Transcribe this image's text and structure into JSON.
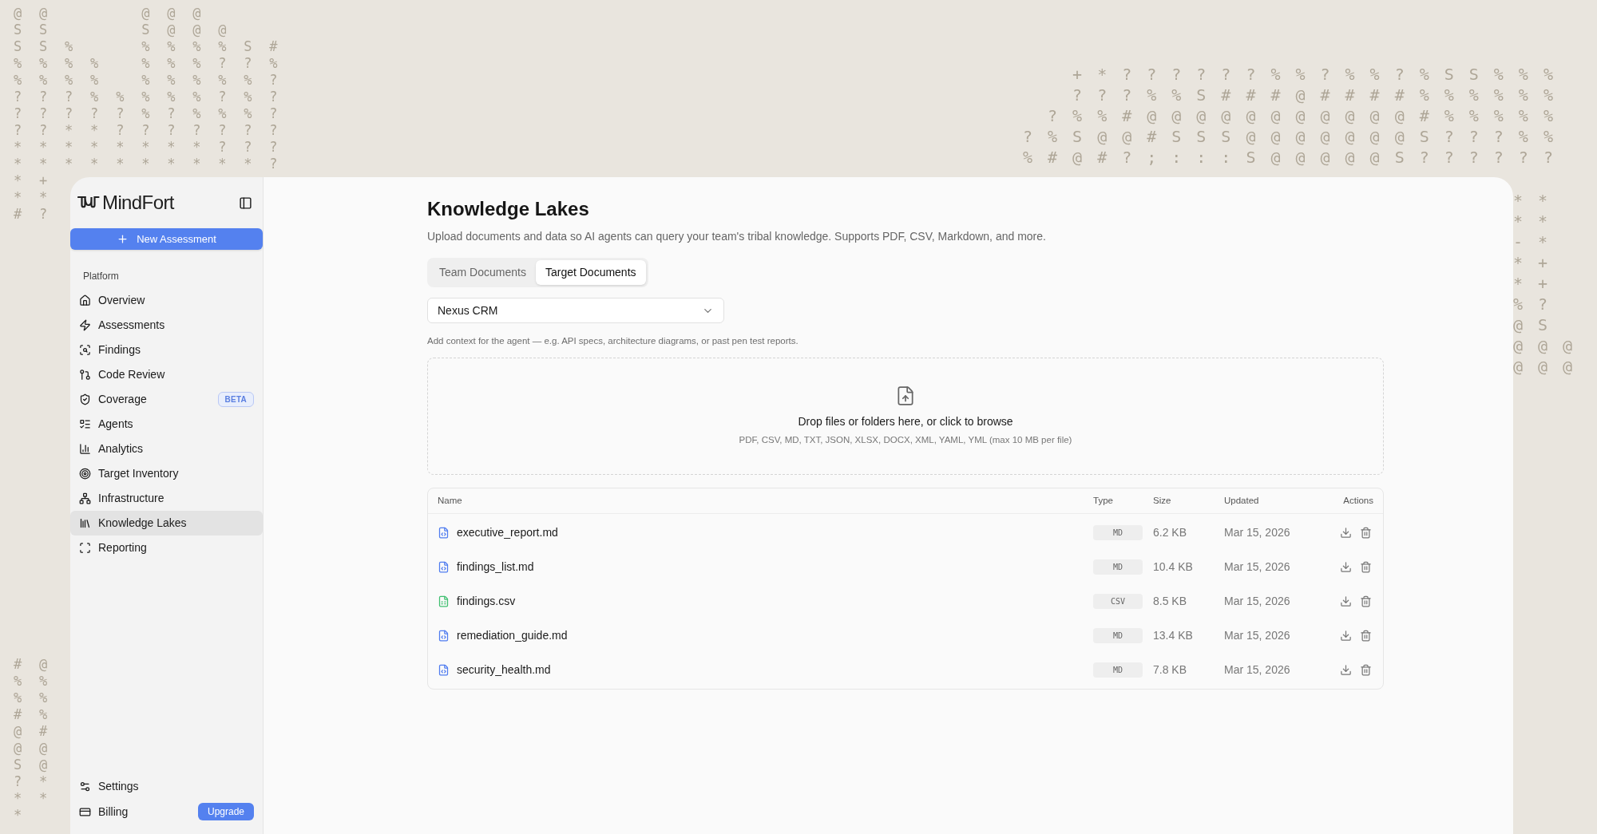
{
  "background_art": {
    "top_left": [
      "@@   @@@   ",
      "SS   S@@@  ",
      "SS%  %%%%S#",
      "%%%% %%%??%",
      "%%%% %%%%%?",
      "???%%%%%?%?",
      "?????%?%%%?",
      "??**???????",
      "********???",
      "**********?",
      "*+",
      "**",
      "#?"
    ],
    "top_right": [
      "   +*??????%%?%%?%SS%%%",
      "   ???%%S###@####%%%%%%",
      "  ?%%#@@@@@@@@@@@#%%%%%",
      " ?%S@@#SSS@@@@@@@S???%%",
      " %#@#?;:::S@@@@@S??????"
    ],
    "right_edge": [
      "**",
      "**",
      "-*",
      "*+",
      "*+",
      "%?",
      "@S",
      "@@@",
      "@@@"
    ],
    "bottom_left": [
      "#@",
      "%%",
      "%%",
      "#%",
      "@#",
      "@@",
      "S@",
      "?*",
      "**",
      "* "
    ]
  },
  "sidebar": {
    "logo": "MindFort",
    "new_button": "New Assessment",
    "section": "Platform",
    "items": [
      {
        "label": "Overview",
        "selected": false
      },
      {
        "label": "Assessments",
        "selected": false
      },
      {
        "label": "Findings",
        "selected": false
      },
      {
        "label": "Code Review",
        "selected": false
      },
      {
        "label": "Coverage",
        "selected": false,
        "badge": {
          "text": "BETA",
          "kind": "beta"
        }
      },
      {
        "label": "Agents",
        "selected": false
      },
      {
        "label": "Analytics",
        "selected": false
      },
      {
        "label": "Target Inventory",
        "selected": false
      },
      {
        "label": "Infrastructure",
        "selected": false
      },
      {
        "label": "Knowledge Lakes",
        "selected": true
      },
      {
        "label": "Reporting",
        "selected": false
      }
    ],
    "footer_items": [
      {
        "label": "Settings"
      },
      {
        "label": "Billing",
        "badge": {
          "text": "Upgrade",
          "kind": "upgrade"
        }
      }
    ]
  },
  "page": {
    "title": "Knowledge Lakes",
    "subtitle": "Upload documents and data so AI agents can query your team's tribal knowledge. Supports PDF, CSV, Markdown, and more.",
    "tabs": [
      {
        "label": "Team Documents",
        "selected": false
      },
      {
        "label": "Target Documents",
        "selected": true
      }
    ],
    "target_select": {
      "value": "Nexus CRM"
    },
    "hint": "Add context for the agent — e.g. API specs, architecture diagrams, or past pen test reports.",
    "dropzone": {
      "title": "Drop files or folders here, or click to browse",
      "formats": "PDF, CSV, MD, TXT, JSON, XLSX, DOCX, XML, YAML, YML (max 10 MB per file)"
    },
    "table": {
      "columns": [
        "Name",
        "Type",
        "Size",
        "Updated",
        "Actions"
      ],
      "rows": [
        {
          "name": "executive_report.md",
          "kind": "markdown",
          "type": "MD",
          "size": "6.2 KB",
          "updated": "Mar 15, 2026"
        },
        {
          "name": "findings_list.md",
          "kind": "markdown",
          "type": "MD",
          "size": "10.4 KB",
          "updated": "Mar 15, 2026"
        },
        {
          "name": "findings.csv",
          "kind": "csv",
          "type": "CSV",
          "size": "8.5 KB",
          "updated": "Mar 15, 2026"
        },
        {
          "name": "remediation_guide.md",
          "kind": "markdown",
          "type": "MD",
          "size": "13.4 KB",
          "updated": "Mar 15, 2026"
        },
        {
          "name": "security_health.md",
          "kind": "markdown",
          "type": "MD",
          "size": "7.8 KB",
          "updated": "Mar 15, 2026"
        }
      ]
    }
  }
}
